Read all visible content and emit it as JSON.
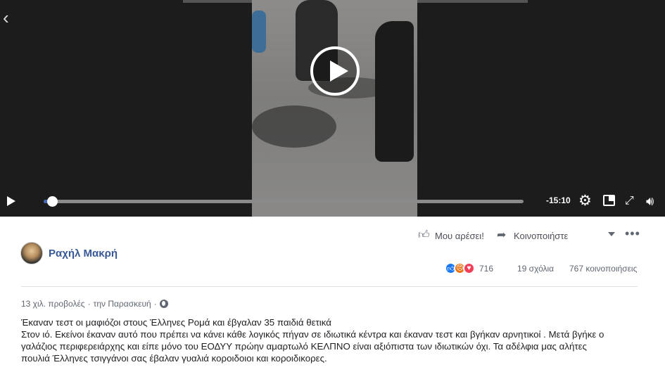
{
  "video": {
    "time_remaining": "-15:10",
    "progress": 0.017
  },
  "actions": {
    "like_label": "Μου αρέσει!",
    "share_label": "Κοινοποιήστε"
  },
  "author": {
    "name": "Ραχήλ Μακρή"
  },
  "stats": {
    "reaction_count": "716",
    "comments": "19 σχόλια",
    "shares": "767 κοινοποιήσεις"
  },
  "meta": {
    "views": "13 χιλ. προβολές",
    "separator": "·",
    "date": "την Παρασκευή",
    "separator2": "·"
  },
  "post": {
    "line1": "Έκαναν τεστ οι μαφιόζοι στους Έλληνες Ρομά και έβγαλαν 35 παιδιά θετικά",
    "line2": "Στον ιό. Εκείνοι έκαναν αυτό που πρέπει να κάνει κάθε λογικός πήγαν σε ιδιωτικά κέντρα και έκαναν τεστ και βγήκαν αρνητικοί . Μετά βγήκε ο",
    "line3": "γαλάζιος περιφερειάρχης και είπε μόνο του ΕΟΔΥΥ πρώην αμαρτωλό ΚΕΛΠΝΟ είναι αξιόπιστα των ιδιωτικών όχι. Τα αδέλφια μας αλήτες",
    "line4": "πουλιά Έλληνες τσιγγάνοι σας έβαλαν γυαλιά κοροιδοιοι και κοροιδικορες."
  },
  "icons": {
    "back": "chevron-left-icon",
    "play": "play-icon",
    "gear": "gear-icon",
    "window": "picture-in-picture-icon",
    "expand": "fullscreen-icon",
    "volume": "volume-icon",
    "thumb": "thumbs-up-icon",
    "share": "share-arrow-icon",
    "globe": "globe-icon"
  },
  "colors": {
    "link": "#385898",
    "seek_fill": "#4267b2",
    "video_bg": "#1c1c1c"
  }
}
